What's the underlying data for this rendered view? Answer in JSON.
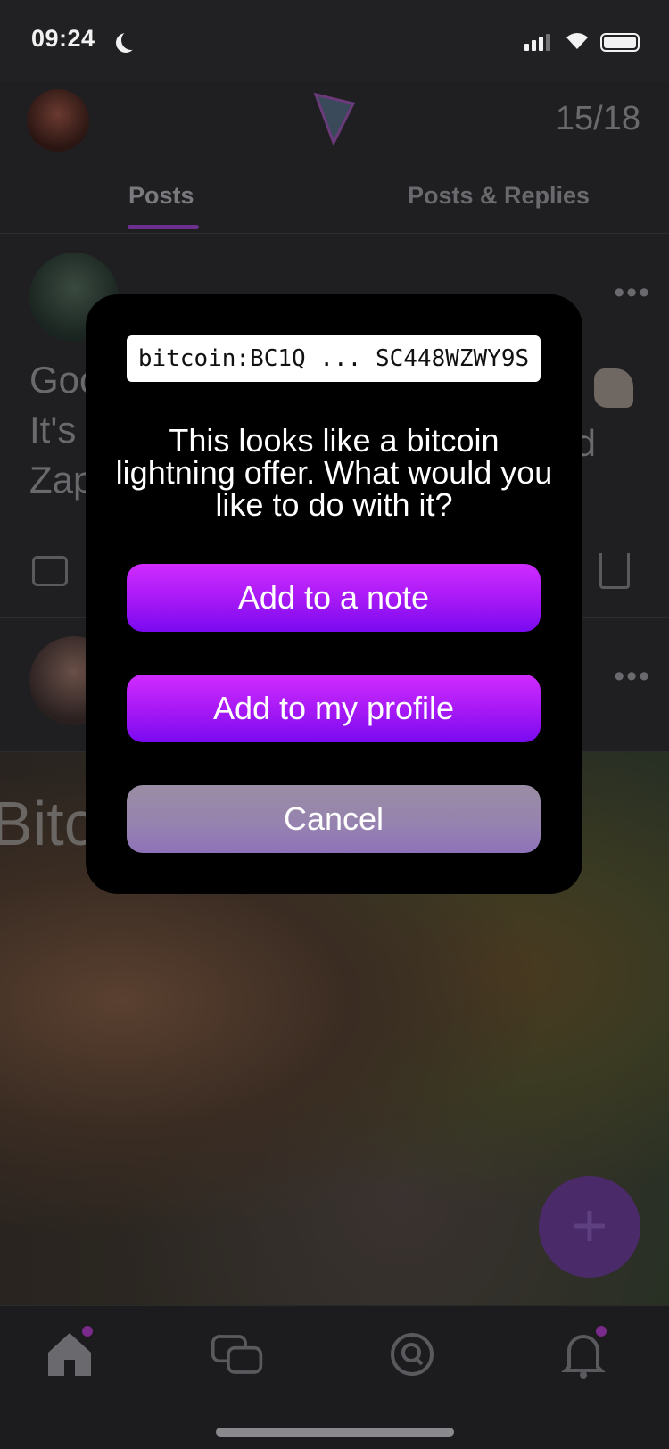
{
  "status_bar": {
    "time": "09:24"
  },
  "header": {
    "counter": "15/18",
    "tabs": [
      {
        "label": "Posts"
      },
      {
        "label": "Posts & Replies"
      }
    ]
  },
  "feed": {
    "post1": {
      "text_line1": "Goo",
      "text_line2": "It's",
      "text_line3": "Zap",
      "text_fragment_right": "d"
    },
    "image_caption": "Bitco"
  },
  "modal": {
    "code_text": "bitcoin:BC1Q ... SC448WZWY9S",
    "message": "This looks like a bitcoin lightning offer. What would you like to do with it?",
    "buttons": {
      "add_note": "Add to a note",
      "add_profile": "Add to my profile",
      "cancel": "Cancel"
    }
  },
  "fab": {
    "icon": "plus-icon"
  },
  "colors": {
    "accent_purple": "#a418f5",
    "cancel_button": "#9682b0",
    "modal_background": "#000000",
    "app_background": "#1f1f21"
  }
}
